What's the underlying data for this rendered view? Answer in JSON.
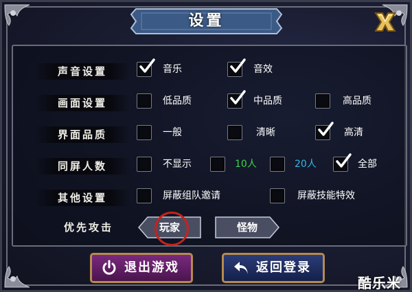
{
  "dialog": {
    "title": "设置"
  },
  "rows": [
    {
      "label": "声音设置",
      "options": [
        {
          "text": "音乐",
          "checked": true
        },
        {
          "text": "音效",
          "checked": true
        }
      ]
    },
    {
      "label": "画面设置",
      "options": [
        {
          "text": "低品质",
          "checked": false
        },
        {
          "text": "中品质",
          "checked": true
        },
        {
          "text": "高品质",
          "checked": false
        }
      ]
    },
    {
      "label": "界面品质",
      "options": [
        {
          "text": "一般",
          "checked": false
        },
        {
          "text": "清晰",
          "checked": false
        },
        {
          "text": "高清",
          "checked": true
        }
      ]
    },
    {
      "label": "同屏人数",
      "options": [
        {
          "text": "不显示",
          "checked": false
        },
        {
          "text": "10人",
          "checked": false
        },
        {
          "text": "20人",
          "checked": false
        },
        {
          "text": "全部",
          "checked": true
        }
      ]
    },
    {
      "label": "其他设置",
      "options": [
        {
          "text": "屏蔽组队邀请",
          "checked": false
        },
        {
          "text": "屏蔽技能特效",
          "checked": false
        }
      ]
    }
  ],
  "priority": {
    "label": "优先攻击",
    "player": "玩家",
    "monster": "怪物",
    "selected": "player"
  },
  "buttons": {
    "exit": "退出游戏",
    "back": "返回登录"
  },
  "watermark": "酷乐米",
  "colors": {
    "highlight_green": "#3fd34a",
    "highlight_cyan": "#36b6e6",
    "exit_button": "#5a1c5e",
    "back_button": "#1c2a5a",
    "gold_border": "#b68b4e",
    "selection_ring": "#c6221c"
  },
  "icons": {
    "close": "close-x-icon",
    "check": "checkmark-icon",
    "power": "power-icon",
    "return": "return-arrow-icon"
  }
}
